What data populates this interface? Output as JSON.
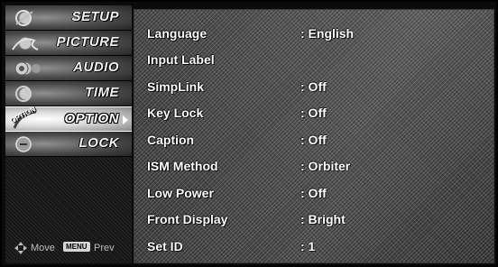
{
  "sidebar": {
    "items": [
      {
        "label": "SETUP",
        "icon": "setup-icon",
        "selected": false
      },
      {
        "label": "PICTURE",
        "icon": "picture-icon",
        "selected": false
      },
      {
        "label": "AUDIO",
        "icon": "audio-icon",
        "selected": false
      },
      {
        "label": "TIME",
        "icon": "time-icon",
        "selected": false
      },
      {
        "label": "OPTION",
        "icon": "option-icon",
        "selected": true,
        "badge": "OPTION"
      },
      {
        "label": "LOCK",
        "icon": "lock-icon",
        "selected": false
      }
    ],
    "footer": {
      "move_icon": "four-way-arrow-icon",
      "move_label": "Move",
      "menu_badge": "MENU",
      "prev_label": "Prev"
    }
  },
  "options": [
    {
      "label": "Language",
      "value": ": English"
    },
    {
      "label": "Input Label",
      "value": ""
    },
    {
      "label": "SimpLink",
      "value": ": Off"
    },
    {
      "label": "Key Lock",
      "value": ": Off"
    },
    {
      "label": "Caption",
      "value": ": Off"
    },
    {
      "label": "ISM Method",
      "value": ": Orbiter"
    },
    {
      "label": "Low Power",
      "value": ": Off"
    },
    {
      "label": "Front Display",
      "value": ": Bright"
    },
    {
      "label": "Set ID",
      "value": ": 1"
    }
  ],
  "colors": {
    "text": "#ffffff",
    "panel": "#333333",
    "sidebar": "#161616",
    "selected_tile": "#d8d8d8"
  }
}
